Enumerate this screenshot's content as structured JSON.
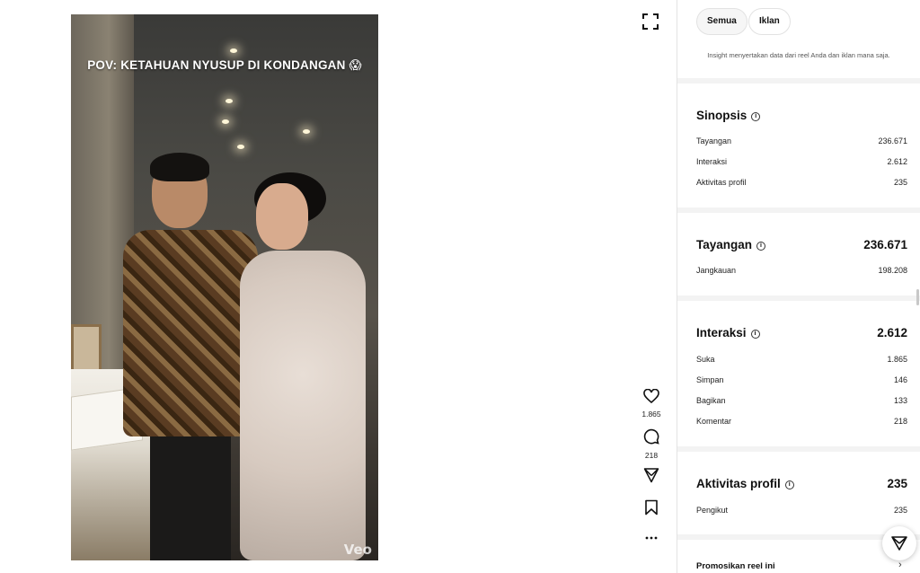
{
  "video": {
    "caption": "POV: KETAHUAN NYUSUP DI KONDANGAN 😱",
    "watermark": "Veo"
  },
  "actions": {
    "likes": "1.865",
    "comments": "218"
  },
  "filters": {
    "all_label": "Semua",
    "ads_label": "Iklan",
    "note": "Insight menyertakan data dari reel Anda dan iklan mana saja."
  },
  "sinopsis": {
    "title": "Sinopsis",
    "rows": [
      {
        "label": "Tayangan",
        "value": "236.671"
      },
      {
        "label": "Interaksi",
        "value": "2.612"
      },
      {
        "label": "Aktivitas profil",
        "value": "235"
      }
    ]
  },
  "tayangan": {
    "title": "Tayangan",
    "value": "236.671",
    "rows": [
      {
        "label": "Jangkauan",
        "value": "198.208"
      }
    ]
  },
  "interaksi": {
    "title": "Interaksi",
    "value": "2.612",
    "rows": [
      {
        "label": "Suka",
        "value": "1.865"
      },
      {
        "label": "Simpan",
        "value": "146"
      },
      {
        "label": "Bagikan",
        "value": "133"
      },
      {
        "label": "Komentar",
        "value": "218"
      }
    ]
  },
  "aktivitas": {
    "title": "Aktivitas profil",
    "value": "235",
    "rows": [
      {
        "label": "Pengikut",
        "value": "235"
      }
    ]
  },
  "promote": {
    "label": "Promosikan reel ini"
  }
}
